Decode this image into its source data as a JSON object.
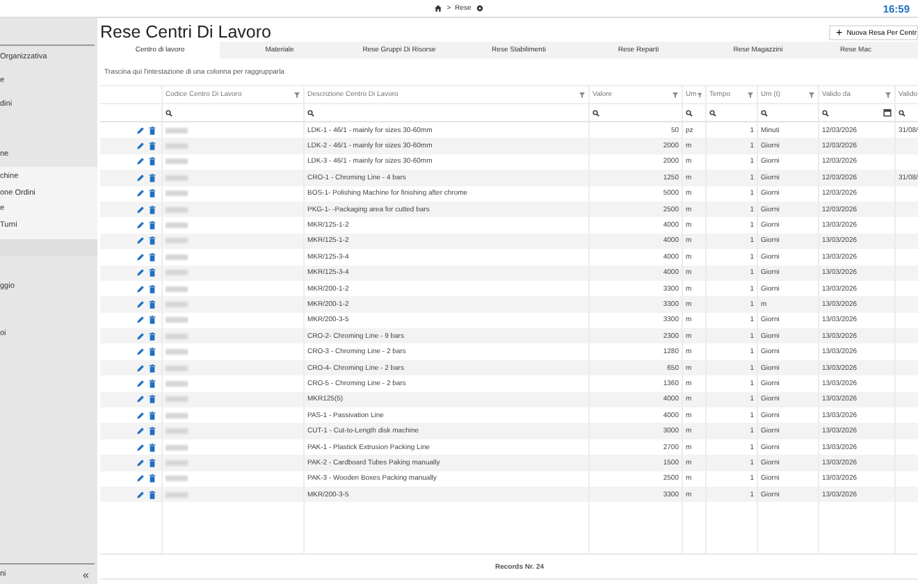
{
  "topbar": {
    "breadcrumb": [
      ">",
      "Rese"
    ],
    "time": "16:59"
  },
  "sidebar": {
    "items": [
      {
        "label": "Organizzativa"
      },
      {
        "label": "e"
      },
      {
        "label": "dini"
      },
      {
        "label": "ne",
        "expanded": true,
        "children": [
          {
            "label": "chine"
          },
          {
            "label": "one Ordini"
          },
          {
            "label": "e"
          },
          {
            "label": "Turni"
          }
        ]
      },
      {
        "label": "ggio"
      },
      {
        "label": "oi"
      }
    ],
    "footer": "ni",
    "collapse": "«"
  },
  "header": {
    "title": "Rese Centri Di Lavoro",
    "new_button": {
      "icon": "+",
      "label": "Nuova Resa Per Centr"
    }
  },
  "tabs": [
    {
      "label": "Centro di lavoro",
      "selected": true
    },
    {
      "label": "Materiale",
      "selected": false
    },
    {
      "label": "Rese Gruppi Di Risorse",
      "selected": false
    },
    {
      "label": "Rese Stabilimenti",
      "selected": false
    },
    {
      "label": "Rese Reparti",
      "selected": false
    },
    {
      "label": "Rese Magazzini",
      "selected": false
    },
    {
      "label": "Rese Mac",
      "selected": false
    }
  ],
  "group_hint": "Trascina qui l'intestazione di una colonna per raggrupparla",
  "table": {
    "columns": [
      {
        "label": "Codice Centro Di Lavoro",
        "kind": "text"
      },
      {
        "label": "Descrizione Centro Di Lavoro",
        "kind": "text"
      },
      {
        "label": "Valore",
        "kind": "number"
      },
      {
        "label": "Um",
        "kind": "text"
      },
      {
        "label": "Tempo",
        "kind": "number"
      },
      {
        "label": "Um (t)",
        "kind": "text"
      },
      {
        "label": "Valido da",
        "kind": "date"
      },
      {
        "label": "Valido",
        "kind": "text"
      }
    ],
    "rows": [
      [
        "",
        "LDK-1 - 46/1 - mainly for sizes 30-60mm",
        "50",
        "pz",
        "1",
        "Minuti",
        "12/03/2026",
        "31/08/"
      ],
      [
        "",
        "LDK-2 - 46/1 - mainly for sizes 30-60mm",
        "2000",
        "m",
        "1",
        "Giorni",
        "12/03/2026",
        ""
      ],
      [
        "",
        "LDK-3 - 46/1 - mainly for sizes 30-60mm",
        "2000",
        "m",
        "1",
        "Giorni",
        "12/03/2026",
        ""
      ],
      [
        "",
        "CRO-1 - Chroming Line - 4 bars",
        "1250",
        "m",
        "1",
        "Giorni",
        "12/03/2026",
        "31/08/"
      ],
      [
        "",
        "BOS-1- Polishing Machine for finishing after chrome",
        "5000",
        "m",
        "1",
        "Giorni",
        "12/03/2026",
        ""
      ],
      [
        "",
        "PKG-1- -Packaging area for cutted bars",
        "2500",
        "m",
        "1",
        "Giorni",
        "12/03/2026",
        ""
      ],
      [
        "",
        "MKR/125-1-2",
        "4000",
        "m",
        "1",
        "Giorni",
        "13/03/2026",
        ""
      ],
      [
        "",
        "MKR/125-1-2",
        "4000",
        "m",
        "1",
        "Giorni",
        "13/03/2026",
        ""
      ],
      [
        "",
        "MKR/125-3-4",
        "4000",
        "m",
        "1",
        "Giorni",
        "13/03/2026",
        ""
      ],
      [
        "",
        "MKR/125-3-4",
        "4000",
        "m",
        "1",
        "Giorni",
        "13/03/2026",
        ""
      ],
      [
        "",
        "MKR/200-1-2",
        "3300",
        "m",
        "1",
        "Giorni",
        "13/03/2026",
        ""
      ],
      [
        "",
        "MKR/200-1-2",
        "3300",
        "m",
        "1",
        "m",
        "13/03/2026",
        ""
      ],
      [
        "",
        "MKR/200-3-5",
        "3300",
        "m",
        "1",
        "Giorni",
        "13/03/2026",
        ""
      ],
      [
        "",
        "CRO-2- Chroming Line - 9 bars",
        "2300",
        "m",
        "1",
        "Giorni",
        "13/03/2026",
        ""
      ],
      [
        "",
        "CRO-3 - Chroming Line - 2 bars",
        "1280",
        "m",
        "1",
        "Giorni",
        "13/03/2026",
        ""
      ],
      [
        "",
        "CRO-4- Chroming Line - 2 bars",
        "650",
        "m",
        "1",
        "Giorni",
        "13/03/2026",
        ""
      ],
      [
        "",
        "CRO-5 - Chroming Line - 2 bars",
        "1360",
        "m",
        "1",
        "Giorni",
        "13/03/2026",
        ""
      ],
      [
        "",
        "MKR125(5)",
        "4000",
        "m",
        "1",
        "Giorni",
        "13/03/2026",
        ""
      ],
      [
        "",
        "PAS-1 - Passivation Line",
        "4000",
        "m",
        "1",
        "Giorni",
        "13/03/2026",
        ""
      ],
      [
        "",
        "CUT-1 - Cut-to-Length disk machine",
        "3000",
        "m",
        "1",
        "Giorni",
        "13/03/2026",
        ""
      ],
      [
        "",
        "PAK-1 - Plastick Extrusion Packing Line",
        "2700",
        "m",
        "1",
        "Giorni",
        "13/03/2026",
        ""
      ],
      [
        "",
        "PAK-2 - Cardboard Tubes Paking manually",
        "1500",
        "m",
        "1",
        "Giorni",
        "13/03/2026",
        ""
      ],
      [
        "",
        "PAK-3 - Wooden Boxes Packing manually",
        "2500",
        "m",
        "1",
        "Giorni",
        "13/03/2026",
        ""
      ],
      [
        "",
        "MKR/200-3-5",
        "3300",
        "m",
        "1",
        "Giorni",
        "13/03/2026",
        ""
      ]
    ],
    "footer": "Records Nr. 24"
  }
}
